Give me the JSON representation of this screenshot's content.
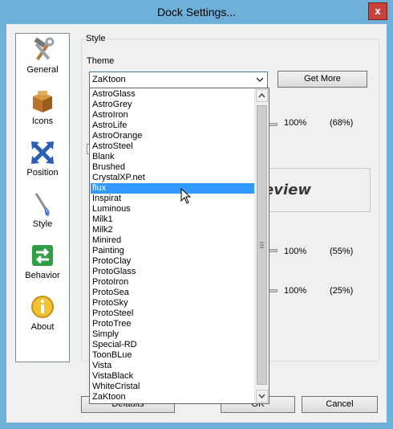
{
  "window": {
    "title": "Dock Settings...",
    "close_label": "x"
  },
  "sidebar": {
    "items": [
      {
        "label": "General",
        "icon": "hammer-wrench-icon"
      },
      {
        "label": "Icons",
        "icon": "box-icon"
      },
      {
        "label": "Position",
        "icon": "arrows-cross-icon"
      },
      {
        "label": "Style",
        "icon": "paintbrush-icon"
      },
      {
        "label": "Behavior",
        "icon": "exchange-arrows-icon"
      },
      {
        "label": "About",
        "icon": "info-icon"
      }
    ]
  },
  "style_group": {
    "label": "Style"
  },
  "theme": {
    "label": "Theme",
    "selected": "ZaKtoon"
  },
  "get_more_label": "Get More",
  "values": {
    "row1_pct": "100%",
    "row1_paren": "(68%)",
    "row2_pct": "100%",
    "row2_paren": "(55%)",
    "row3_pct": "100%",
    "row3_paren": "(25%)"
  },
  "preview_fragment": "eview",
  "buttons": {
    "defaults": "Defaults",
    "ok": "OK",
    "cancel": "Cancel"
  },
  "dropdown_options": [
    "AstroGlass",
    "AstroGrey",
    "AstroIron",
    "AstroLife",
    "AstroOrange",
    "AstroSteel",
    "Blank",
    "Brushed",
    "CrystalXP.net",
    "flux",
    "Inspirat",
    "Luminous",
    "Milk1",
    "Milk2",
    "Minired",
    "Painting",
    "ProtoClay",
    "ProtoGlass",
    "ProtoIron",
    "ProtoSea",
    "ProtoSky",
    "ProtoSteel",
    "ProtoTree",
    "Simply",
    "Special-RD",
    "ToonBLue",
    "Vista",
    "VistaBlack",
    "WhiteCristal",
    "ZaKtoon"
  ],
  "highlighted_option": "flux",
  "colors": {
    "titlebar": "#6eb0d8",
    "selection": "#3399ff",
    "close": "#c7423a"
  }
}
